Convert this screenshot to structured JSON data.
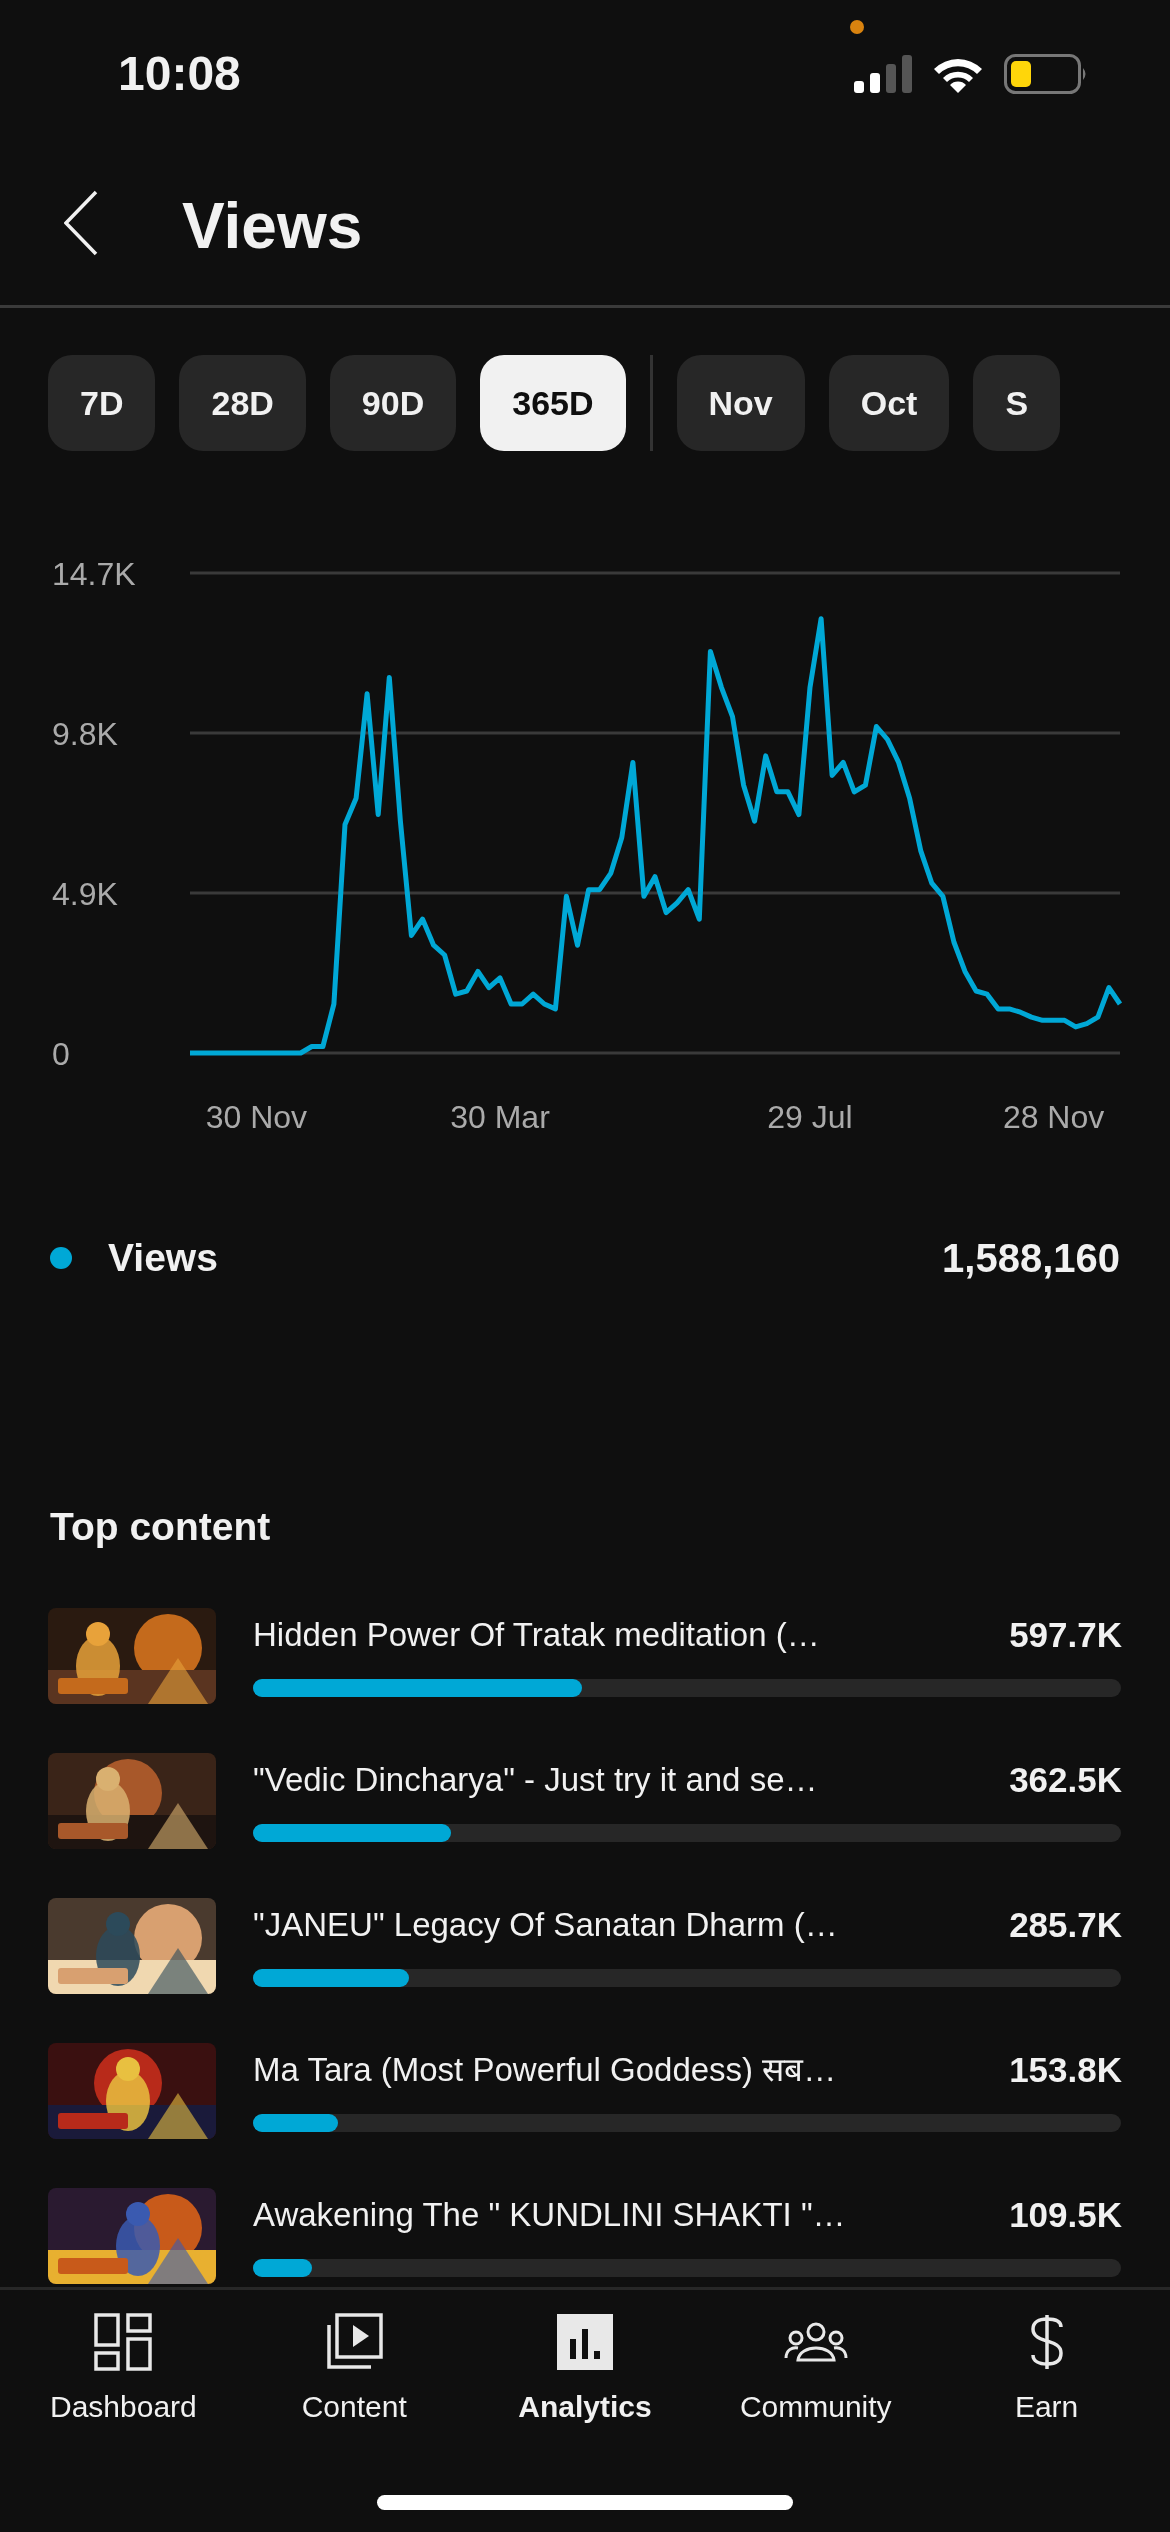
{
  "status_bar": {
    "time": "10:08"
  },
  "header": {
    "title": "Views"
  },
  "range_tabs": [
    {
      "label": "7D",
      "selected": false
    },
    {
      "label": "28D",
      "selected": false
    },
    {
      "label": "90D",
      "selected": false
    },
    {
      "label": "365D",
      "selected": true
    },
    {
      "label": "Nov",
      "selected": false
    },
    {
      "label": "Oct",
      "selected": false
    },
    {
      "label": "S",
      "selected": false
    }
  ],
  "chart": {
    "chart_data": {
      "type": "line",
      "ylim": [
        0,
        14700
      ],
      "yticks": [
        {
          "value": 0,
          "label": "0"
        },
        {
          "value": 4900,
          "label": "4.9K"
        },
        {
          "value": 9800,
          "label": "9.8K"
        },
        {
          "value": 14700,
          "label": "14.7K"
        }
      ],
      "categories": [
        null,
        null,
        null,
        null,
        null,
        null,
        "30 Nov",
        null,
        null,
        null,
        null,
        null,
        null,
        null,
        null,
        null,
        null,
        null,
        null,
        null,
        null,
        null,
        null,
        null,
        null,
        null,
        null,
        null,
        "30 Mar",
        null,
        null,
        null,
        null,
        null,
        null,
        null,
        null,
        null,
        null,
        null,
        null,
        null,
        null,
        null,
        null,
        null,
        null,
        null,
        null,
        null,
        null,
        null,
        null,
        null,
        null,
        null,
        "29 Jul",
        null,
        null,
        null,
        null,
        null,
        null,
        null,
        null,
        null,
        null,
        null,
        null,
        null,
        null,
        null,
        null,
        null,
        null,
        null,
        null,
        null,
        "28 Nov",
        null,
        null,
        null,
        null,
        null,
        null
      ],
      "series": [
        {
          "name": "Views",
          "color": "#00a8d6",
          "values": [
            0,
            0,
            0,
            0,
            0,
            0,
            0,
            0,
            0,
            0,
            0,
            200,
            200,
            1500,
            7000,
            7800,
            11000,
            7300,
            11500,
            7100,
            3600,
            4100,
            3300,
            3000,
            1800,
            1900,
            2500,
            2000,
            2300,
            1500,
            1500,
            1800,
            1500,
            1350,
            4800,
            3300,
            5000,
            5000,
            5500,
            6600,
            8900,
            4800,
            5400,
            4300,
            4600,
            5000,
            4100,
            12300,
            11200,
            10300,
            8200,
            7100,
            9100,
            8000,
            8000,
            7300,
            11200,
            13300,
            8500,
            8900,
            8000,
            8200,
            10000,
            9600,
            8900,
            7800,
            6200,
            5200,
            4800,
            3400,
            2500,
            1900,
            1800,
            1350,
            1350,
            1250,
            1100,
            1000,
            1000,
            1000,
            800,
            900,
            1100,
            2000,
            1500
          ]
        }
      ]
    }
  },
  "legend": {
    "value": "1,588,160"
  },
  "top_content": {
    "title": "Top content",
    "items": [
      {
        "title": "Hidden Power Of Tratak meditation (…",
        "value": "597.7K",
        "level": 0.379
      },
      {
        "title": "\"Vedic Dincharya\" - Just try it and se…",
        "value": "362.5K",
        "level": 0.228
      },
      {
        "title": "\"JANEU\" Legacy Of Sanatan Dharm (…",
        "value": "285.7K",
        "level": 0.18
      },
      {
        "title": "Ma Tara (Most Powerful Goddess) सब…",
        "value": "153.8K",
        "level": 0.098
      },
      {
        "title": "Awakening The \" KUNDLINI SHAKTI \"…",
        "value": "109.5K",
        "level": 0.068
      }
    ]
  },
  "bottom_nav": [
    {
      "label": "Dashboard",
      "selected": false
    },
    {
      "label": "Content",
      "selected": false
    },
    {
      "label": "Analytics",
      "selected": true
    },
    {
      "label": "Community",
      "selected": false
    },
    {
      "label": "Earn",
      "selected": false
    }
  ]
}
